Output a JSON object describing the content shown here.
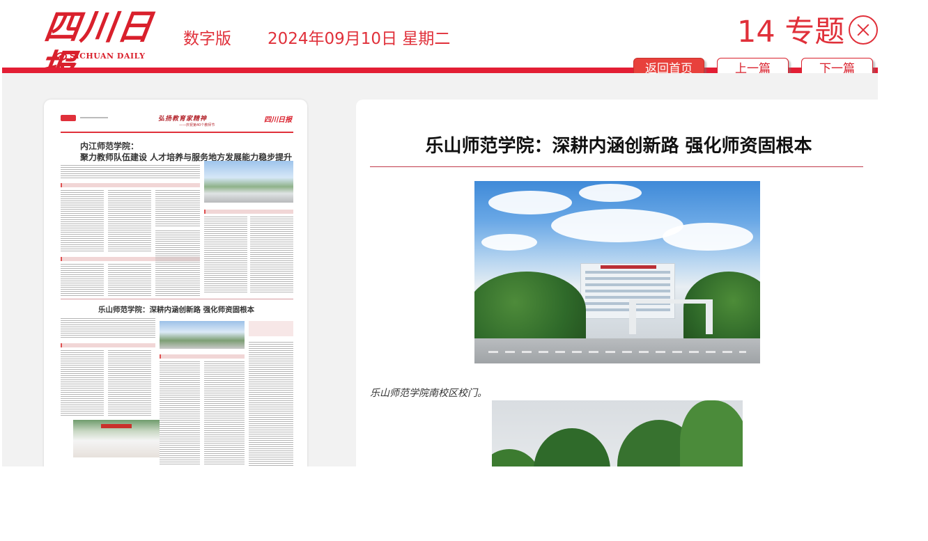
{
  "header": {
    "logo_cn": "四川日报",
    "logo_en": "SICHUAN DAILY",
    "edition": "数字版",
    "date": "2024年09月10日 星期二",
    "page_label": "14 专题"
  },
  "nav": {
    "home_label": "返回首页",
    "prev_label": "上一篇",
    "next_label": "下一篇"
  },
  "newspaper": {
    "banner": "弘扬教育家精神",
    "banner_sub": "——庆祝第40个教师节",
    "logo_mini": "四川日报",
    "headline1_line1": "内江师范学院：",
    "headline1_line2": "聚力教师队伍建设 人才培养与服务地方发展能力稳步提升",
    "headline2": "乐山师范学院：深耕内涵创新路 强化师资固根本"
  },
  "article": {
    "title": "乐山师范学院：深耕内涵创新路 强化师资固根本",
    "caption": "乐山师范学院南校区校门。"
  },
  "colors": {
    "brand_red": "#e31e34",
    "text_red": "#e0303a",
    "home_button_bg": "#e8413c",
    "content_bg": "#f2f2f2"
  },
  "icons": {
    "close": "close-circle-icon",
    "logo_emblem": "sichuan-daily-emblem-icon"
  }
}
